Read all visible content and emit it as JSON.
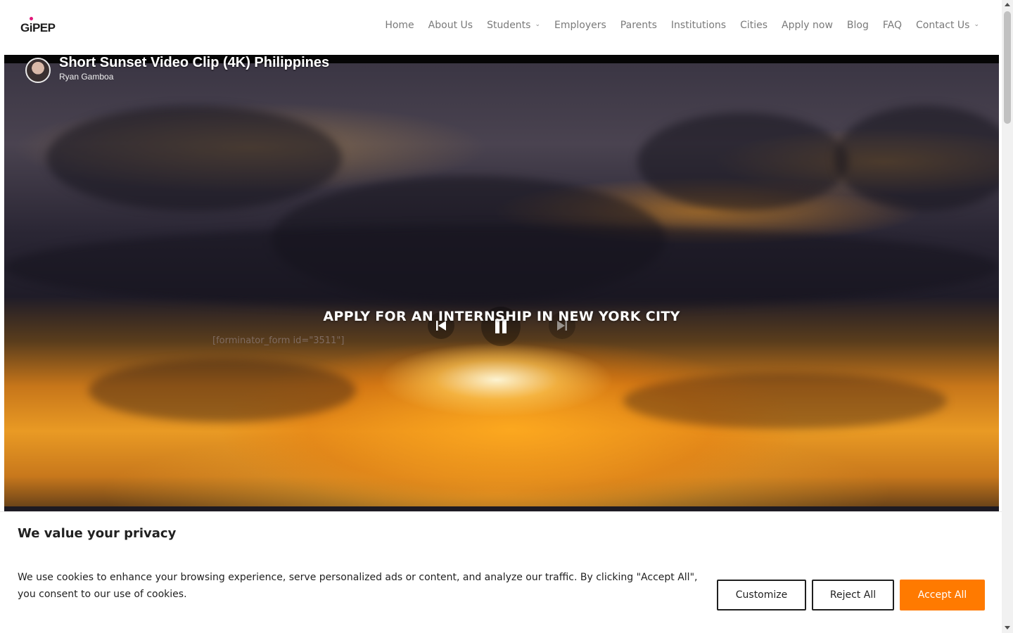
{
  "header": {
    "logo_text": "GiPEP",
    "nav": [
      {
        "label": "Home",
        "has_dropdown": false
      },
      {
        "label": "About Us",
        "has_dropdown": false
      },
      {
        "label": "Students",
        "has_dropdown": true
      },
      {
        "label": "Employers",
        "has_dropdown": false
      },
      {
        "label": "Parents",
        "has_dropdown": false
      },
      {
        "label": "Institutions",
        "has_dropdown": false
      },
      {
        "label": "Cities",
        "has_dropdown": false
      },
      {
        "label": "Apply now",
        "has_dropdown": false
      },
      {
        "label": "Blog",
        "has_dropdown": false
      },
      {
        "label": "FAQ",
        "has_dropdown": false
      },
      {
        "label": "Contact Us",
        "has_dropdown": true
      }
    ]
  },
  "video": {
    "title": "Short Sunset Video Clip (4K) Philippines",
    "channel": "Ryan Gamboa",
    "controls": {
      "prev_icon": "skip-previous-icon",
      "play_icon": "pause-icon",
      "next_icon": "skip-next-icon"
    }
  },
  "hero": {
    "heading": "APPLY FOR AN INTERNSHIP IN NEW YORK CITY",
    "shortcode": "[forminator_form id=\"3511\"]"
  },
  "cookie": {
    "title": "We value your privacy",
    "text": "We use cookies to enhance your browsing experience, serve personalized ads or content, and analyze our traffic. By clicking \"Accept All\", you consent to our use of cookies.",
    "buttons": {
      "customize": "Customize",
      "reject": "Reject All",
      "accept": "Accept All"
    }
  },
  "colors": {
    "accent": "#ff7a00",
    "nav_text": "#7a7a7a",
    "brand_dot": "#e2187a"
  }
}
